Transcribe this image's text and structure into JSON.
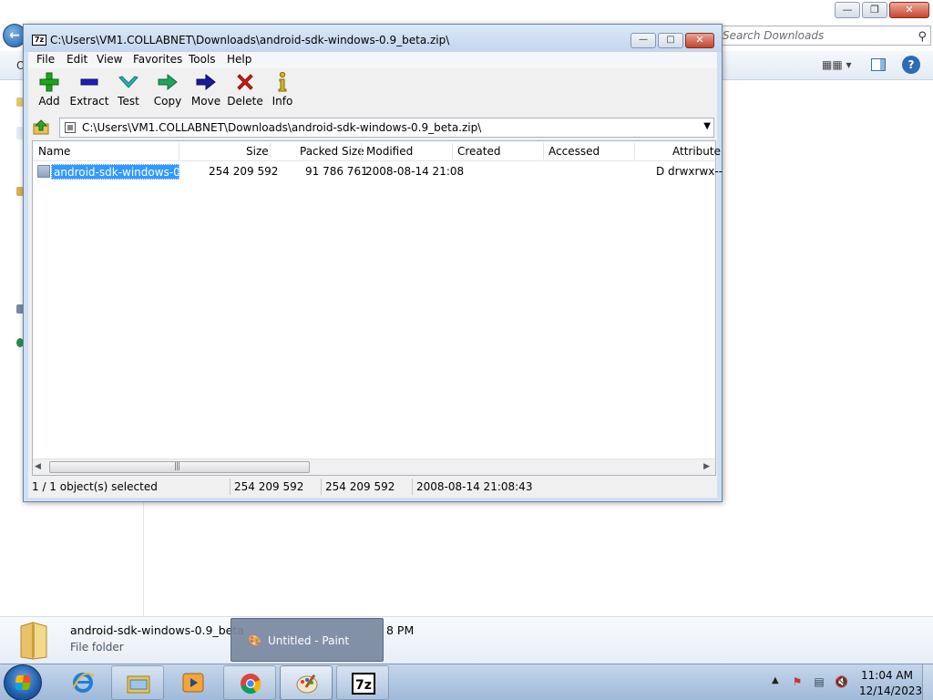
{
  "explorer": {
    "search_placeholder": "Search Downloads",
    "toolbar_fragment": "O",
    "details": {
      "name": "android-sdk-windows-0.9_beta",
      "type": "File folder",
      "extra": "8 PM"
    }
  },
  "sevenzip": {
    "title": "C:\\Users\\VM1.COLLABNET\\Downloads\\android-sdk-windows-0.9_beta.zip\\",
    "title_icon": "7z",
    "menu": [
      "File",
      "Edit",
      "View",
      "Favorites",
      "Tools",
      "Help"
    ],
    "toolbar": {
      "add": "Add",
      "extract": "Extract",
      "test": "Test",
      "copy": "Copy",
      "move": "Move",
      "delete": "Delete",
      "info": "Info"
    },
    "address": "C:\\Users\\VM1.COLLABNET\\Downloads\\android-sdk-windows-0.9_beta.zip\\",
    "columns": {
      "name": "Name",
      "size": "Size",
      "packed_size": "Packed Size",
      "modified": "Modified",
      "created": "Created",
      "accessed": "Accessed",
      "attributes": "Attribute"
    },
    "rows": [
      {
        "name": "android-sdk-windows-0...",
        "size": "254 209 592",
        "packed_size": "91 786 761",
        "modified": "2008-08-14 21:08",
        "created": "",
        "accessed": "",
        "attributes": "D drwxrwx--"
      }
    ],
    "status": {
      "selection": "1 / 1 object(s) selected",
      "size": "254 209 592",
      "size2": "254 209 592",
      "modified": "2008-08-14 21:08:43"
    }
  },
  "paint_thumb": {
    "title": "Untitled - Paint"
  },
  "taskbar": {
    "items": [
      "start",
      "internet-explorer",
      "windows-explorer",
      "media-player",
      "chrome",
      "paint",
      "7-zip"
    ],
    "clock_time": "11:04 AM",
    "clock_date": "12/14/2023"
  }
}
